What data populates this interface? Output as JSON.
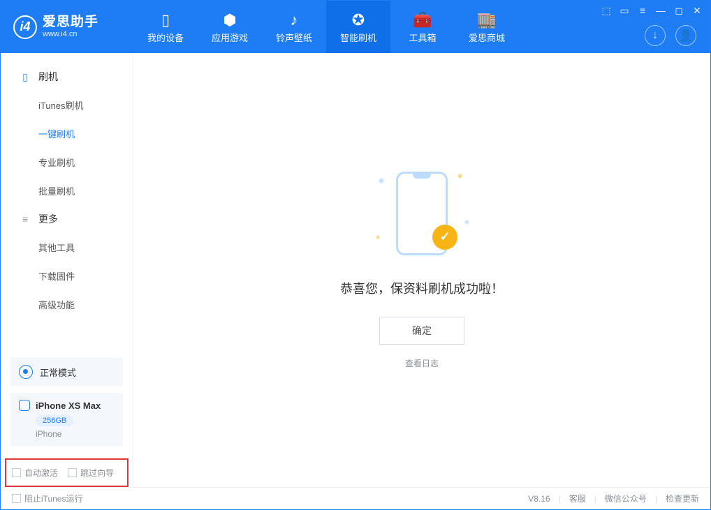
{
  "app": {
    "title_cn": "爱思助手",
    "title_en": "www.i4.cn"
  },
  "header_nav": {
    "items": [
      {
        "label": "我的设备",
        "icon": "▯"
      },
      {
        "label": "应用游戏",
        "icon": "⬢"
      },
      {
        "label": "铃声壁纸",
        "icon": "♪"
      },
      {
        "label": "智能刷机",
        "icon": "✪"
      },
      {
        "label": "工具箱",
        "icon": "🧰"
      },
      {
        "label": "爱思商城",
        "icon": "🏬"
      }
    ],
    "active_index": 3
  },
  "window_controls": [
    "⬚",
    "▭",
    "≡",
    "—",
    "◻",
    "✕"
  ],
  "header_right_icons": {
    "download": "↓",
    "user": "👤"
  },
  "sidebar": {
    "categories": [
      {
        "title": "刷机",
        "icon": "▯",
        "items": [
          "iTunes刷机",
          "一键刷机",
          "专业刷机",
          "批量刷机"
        ],
        "active_index": 1
      },
      {
        "title": "更多",
        "icon": "≡",
        "items": [
          "其他工具",
          "下载固件",
          "高级功能"
        ],
        "active_index": -1
      }
    ]
  },
  "device_panel": {
    "status_label": "正常模式",
    "device_name": "iPhone XS Max",
    "capacity": "256GB",
    "device_type": "iPhone"
  },
  "highlight_options": {
    "auto_activate": "自动激活",
    "skip_guide": "跳过向导"
  },
  "main": {
    "success_message": "恭喜您，保资料刷机成功啦！",
    "ok_button": "确定",
    "view_log": "查看日志"
  },
  "footer": {
    "block_itunes": "阻止iTunes运行",
    "version": "V8.16",
    "links": [
      "客服",
      "微信公众号",
      "检查更新"
    ]
  }
}
